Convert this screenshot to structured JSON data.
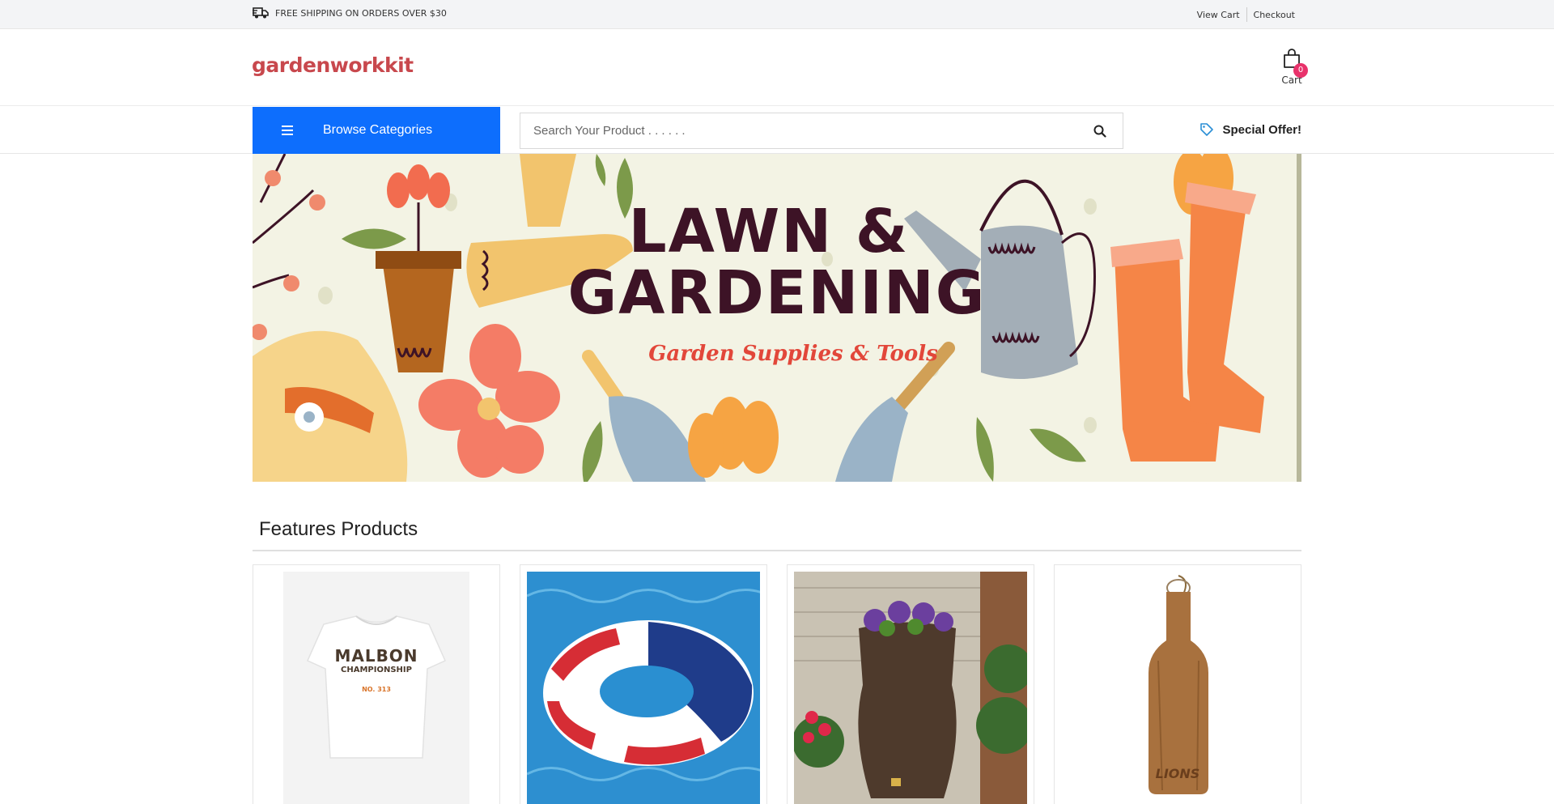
{
  "topbar": {
    "shipping_text": "FREE SHIPPING ON ORDERS OVER $30",
    "links": [
      "View Cart",
      "Checkout"
    ]
  },
  "header": {
    "logo": "gardenworkkit",
    "cart_count": "0",
    "cart_label": "Cart"
  },
  "nav": {
    "browse_label": "Browse Categories",
    "search_placeholder": "Search Your Product . . . . . .",
    "offer_label": "Special Offer!"
  },
  "hero": {
    "title_line1": "LAWN &",
    "title_line2": "GARDENING",
    "subtitle": "Garden Supplies & Tools"
  },
  "features": {
    "title": "Features Products",
    "products": [
      {
        "image": "white-tshirt",
        "print_lines": [
          "MALBON",
          "CHAMPIONSHIP",
          "NO. 313"
        ]
      },
      {
        "image": "flag-pool-float"
      },
      {
        "image": "rain-barrel-planter"
      },
      {
        "image": "wooden-serving-board",
        "engraving": "LIONS"
      }
    ]
  },
  "colors": {
    "brand_red": "#c8484d",
    "primary_blue": "#0d6efd",
    "badge_pink": "#e8326b",
    "hero_bg": "#f3f3e4",
    "hero_title": "#3d1326",
    "hero_subtitle": "#e2473a"
  },
  "icons": {
    "shipping": "truck-icon",
    "cart": "shopping-bag-icon",
    "menu": "hamburger-icon",
    "search": "search-icon",
    "offer": "tag-icon"
  }
}
